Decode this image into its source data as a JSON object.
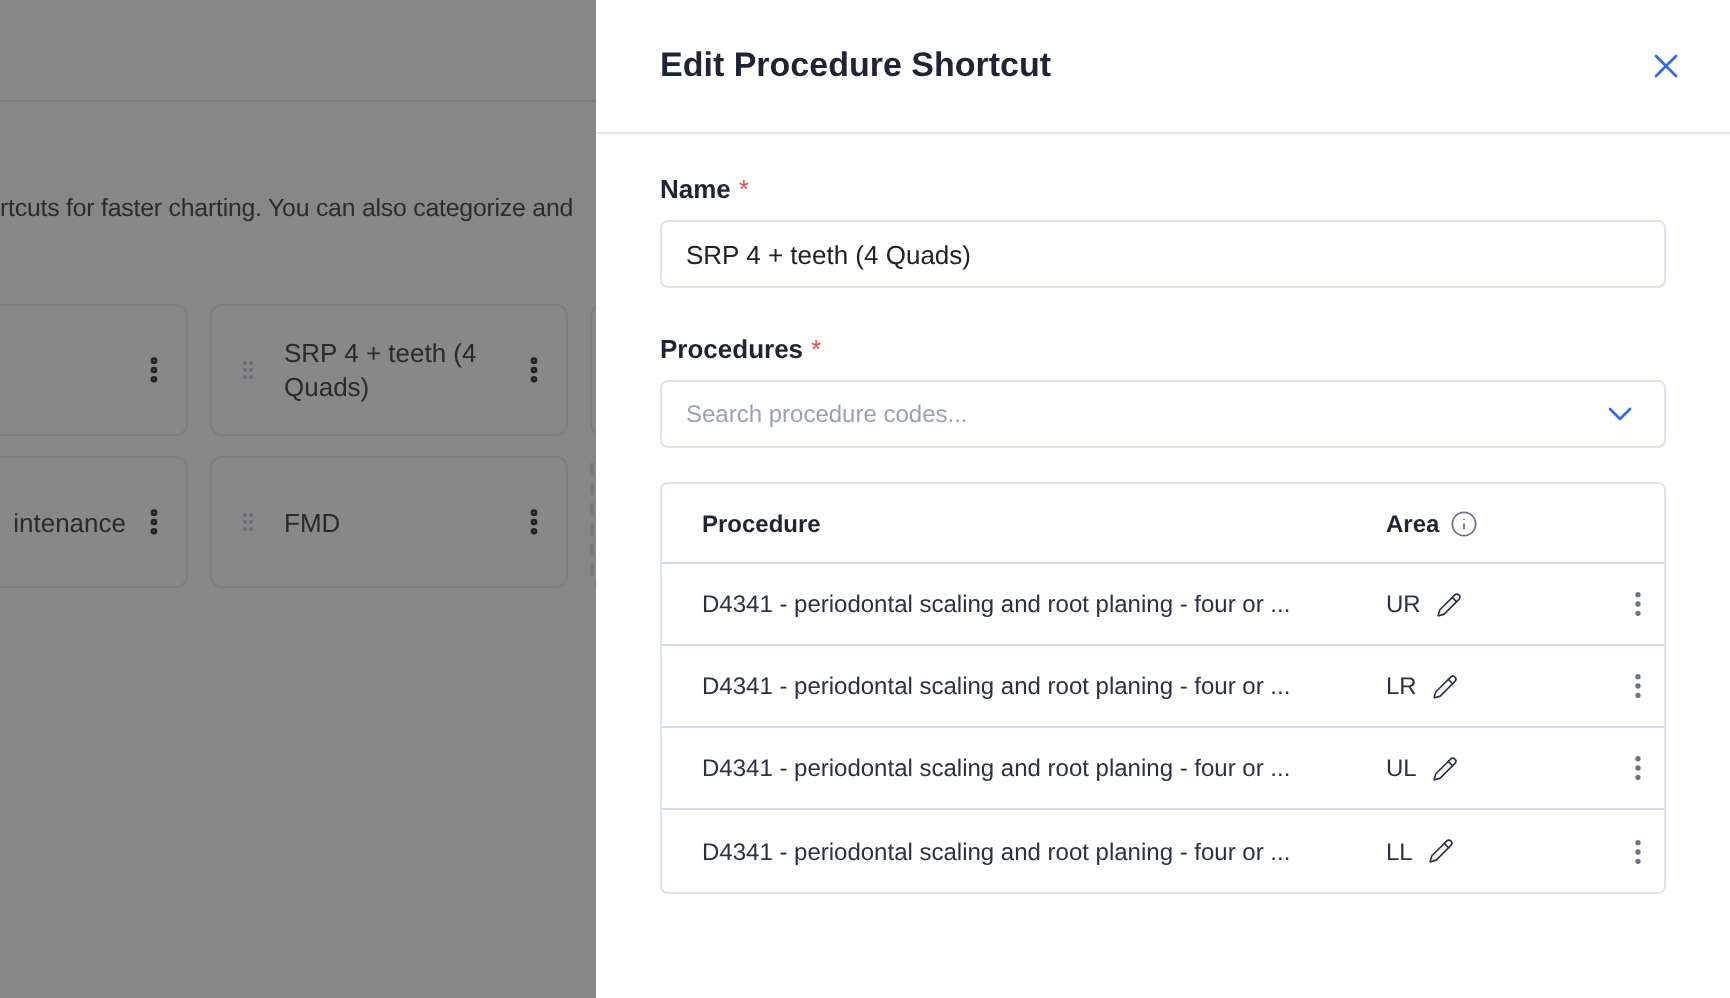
{
  "background": {
    "description": "rtcuts for faster charting. You can also categorize and",
    "cards": [
      {
        "kind": "card"
      },
      {
        "label": "SRP 4 + teeth (4 Quads)",
        "kind": "card"
      },
      {
        "kind": "card"
      },
      {
        "label": "intenance",
        "kind": "card"
      },
      {
        "label": "FMD",
        "kind": "card"
      },
      {
        "kind": "dashed"
      }
    ]
  },
  "panel": {
    "title": "Edit Procedure Shortcut",
    "name_field": {
      "label": "Name",
      "required_mark": "*",
      "value": "SRP 4 + teeth (4 Quads)"
    },
    "procedures_field": {
      "label": "Procedures",
      "required_mark": "*",
      "placeholder": "Search procedure codes..."
    },
    "table": {
      "columns": [
        "Procedure",
        "Area"
      ],
      "rows": [
        {
          "procedure": "D4341 - periodontal scaling and root planing - four or ...",
          "area": "UR"
        },
        {
          "procedure": "D4341 - periodontal scaling and root planing - four or ...",
          "area": "LR"
        },
        {
          "procedure": "D4341 - periodontal scaling and root planing - four or ...",
          "area": "UL"
        },
        {
          "procedure": "D4341 - periodontal scaling and root planing - four or ...",
          "area": "LL"
        }
      ]
    }
  }
}
